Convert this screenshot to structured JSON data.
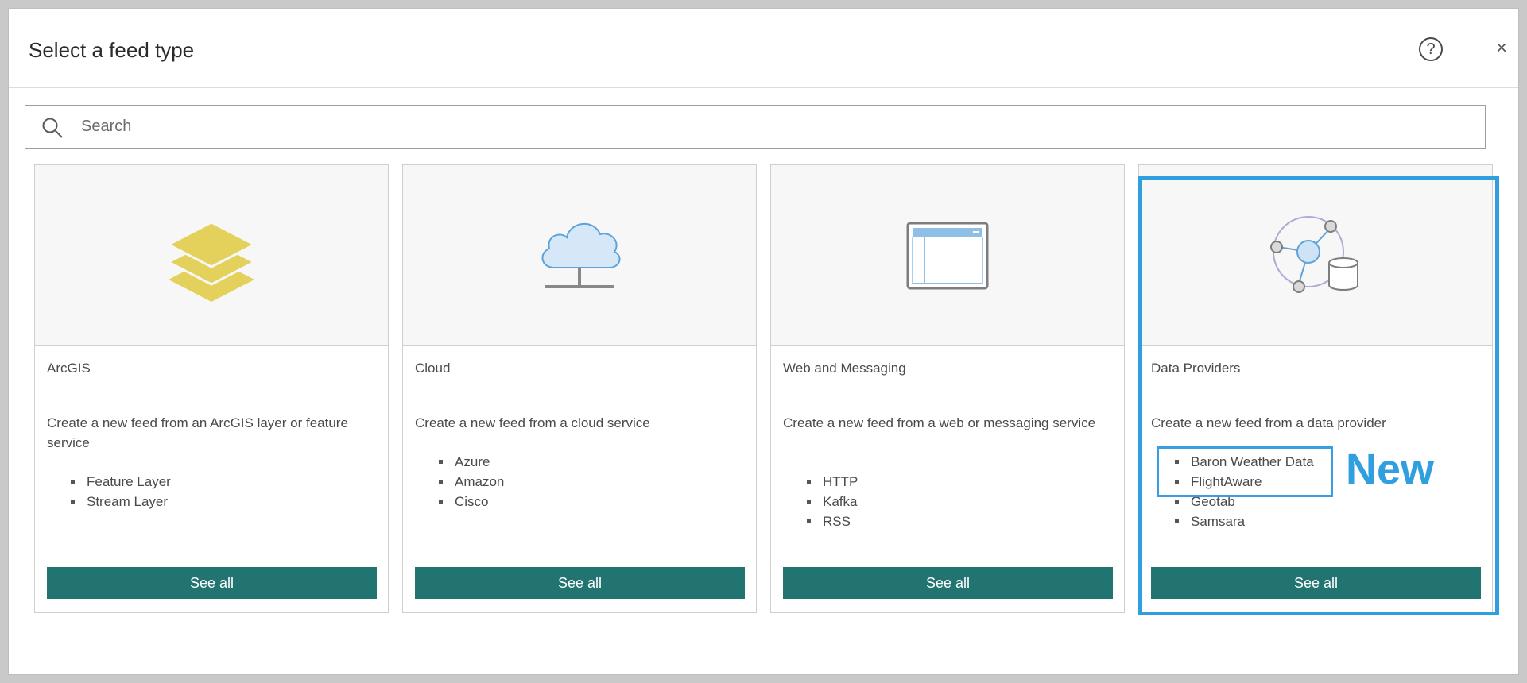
{
  "dialog": {
    "title": "Select a feed type",
    "help_icon": "question-circle-icon",
    "help_glyph": "?",
    "close_icon": "close-icon",
    "close_glyph": "×"
  },
  "search": {
    "placeholder": "Search",
    "value": "",
    "icon": "search-icon"
  },
  "cards": [
    {
      "title": "ArcGIS",
      "description": "Create a new feed from an ArcGIS layer or feature service",
      "items": [
        "Feature Layer",
        "Stream Layer"
      ],
      "button": "See all",
      "icon": "layers-icon"
    },
    {
      "title": "Cloud",
      "description": "Create a new feed from a cloud service",
      "items": [
        "Azure",
        "Amazon",
        "Cisco"
      ],
      "button": "See all",
      "icon": "cloud-network-icon"
    },
    {
      "title": "Web and Messaging",
      "description": "Create a new feed from a web or messaging service",
      "items": [
        "HTTP",
        "Kafka",
        "RSS"
      ],
      "button": "See all",
      "icon": "browser-window-icon"
    },
    {
      "title": "Data Providers",
      "description": "Create a new feed from a data provider",
      "items": [
        "Baron Weather Data",
        "FlightAware",
        "Geotab",
        "Samsara"
      ],
      "button": "See all",
      "icon": "data-provider-network-icon"
    }
  ],
  "annotation": {
    "label": "New",
    "color": "#2f9fe0"
  },
  "colors": {
    "button_bg": "#217470",
    "highlight": "#2f9fe0",
    "layers_fill": "#e3d15b"
  }
}
